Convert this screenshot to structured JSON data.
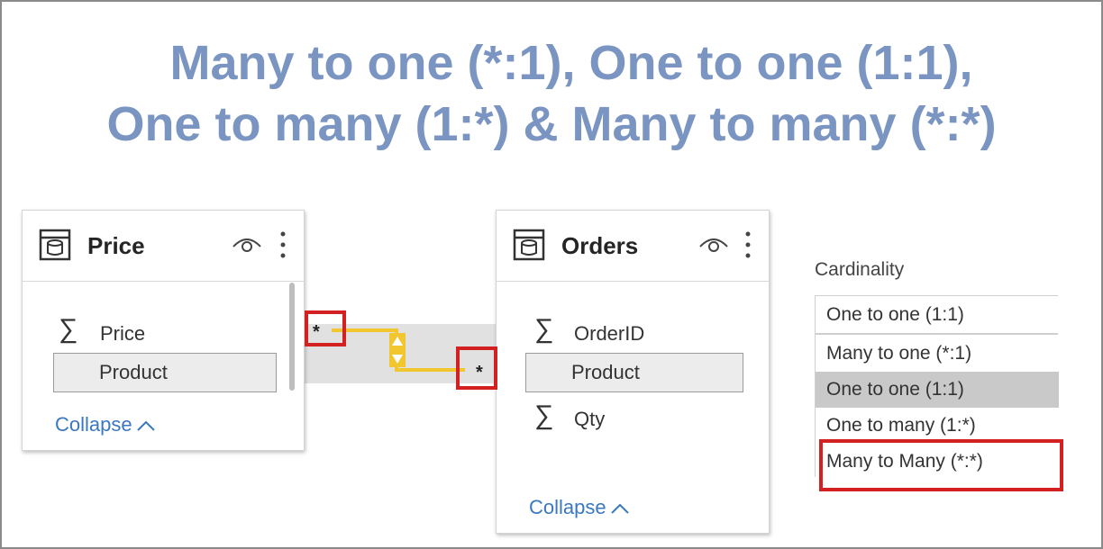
{
  "title": {
    "line1": "Many to one (*:1), One to one (1:1),",
    "line2": "One to many (1:*) & Many to many (*:*)"
  },
  "tables": {
    "price": {
      "name": "Price",
      "fields": [
        {
          "label": "Price",
          "icon": "sigma-icon"
        },
        {
          "label": "Product",
          "icon": "none",
          "highlighted": true
        }
      ],
      "collapse_label": "Collapse"
    },
    "orders": {
      "name": "Orders",
      "fields": [
        {
          "label": "OrderID",
          "icon": "sigma-icon"
        },
        {
          "label": "Product",
          "icon": "none",
          "highlighted": true
        },
        {
          "label": "Qty",
          "icon": "sigma-icon"
        }
      ],
      "collapse_label": "Collapse"
    }
  },
  "relationship": {
    "left_end": "*",
    "right_end": "*",
    "line_color": "#f2c62f",
    "highlight_color": "#d32020"
  },
  "cardinality": {
    "label": "Cardinality",
    "selected_value": "One to one (1:1)",
    "options": [
      {
        "label": "Many to one (*:1)",
        "state": "normal"
      },
      {
        "label": "One to one (1:1)",
        "state": "hovered"
      },
      {
        "label": "One to many (1:*)",
        "state": "normal"
      },
      {
        "label": "Many to Many (*:*)",
        "state": "outlined"
      }
    ]
  },
  "colors": {
    "title": "#7b95c2",
    "link": "#3a78c0"
  }
}
